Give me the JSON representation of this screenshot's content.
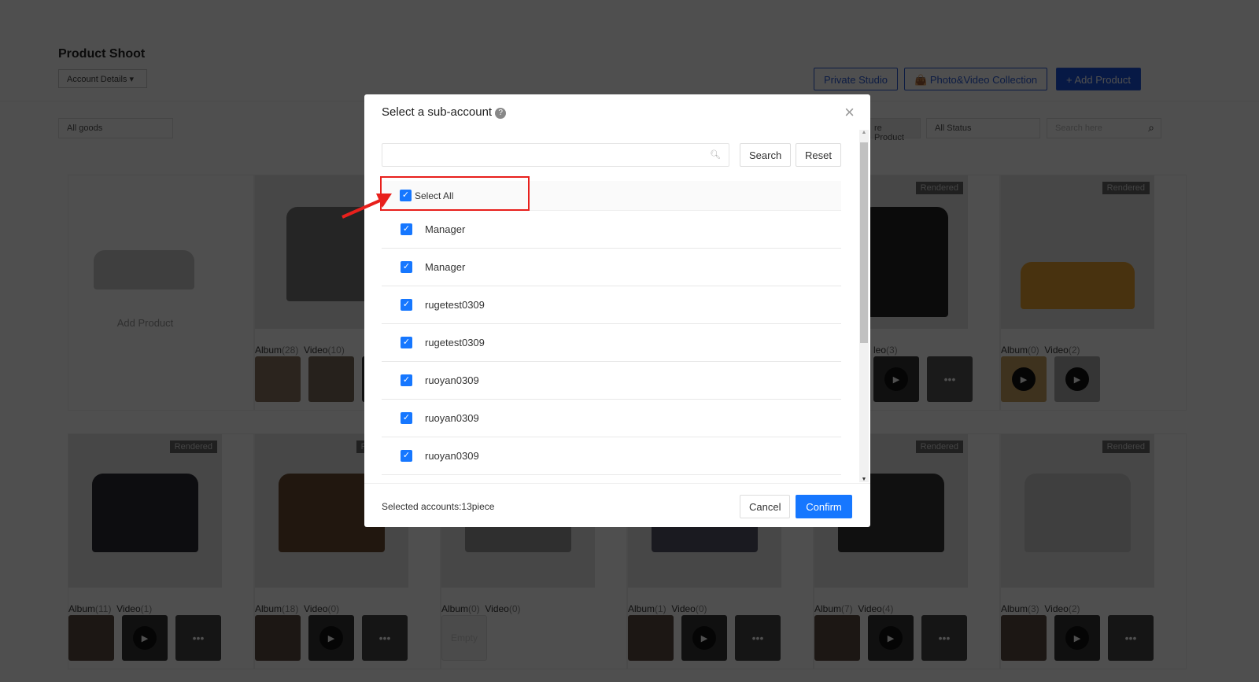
{
  "header": {
    "title": "Product Shoot",
    "account_dropdown": "Account Details",
    "private_studio": "Private Studio",
    "collection": "Photo&Video Collection",
    "add_product": "Add Product"
  },
  "filters": {
    "goods": "All goods",
    "product_tab": "re Product",
    "status": "All Status",
    "search_placeholder": "Search here"
  },
  "add_card": {
    "label": "Add Product"
  },
  "badge": "Rendered",
  "row1": [
    {
      "album": "Album",
      "album_n": "(28)",
      "video": "Video",
      "video_n": "(10)"
    },
    {
      "video": "leo",
      "video_n": "(3)"
    },
    {
      "album": "Album",
      "album_n": "(0)",
      "video": "Video",
      "video_n": "(2)"
    }
  ],
  "row2": [
    {
      "album": "Album",
      "album_n": "(11)",
      "video": "Video",
      "video_n": "(1)"
    },
    {
      "album": "Album",
      "album_n": "(18)",
      "video": "Video",
      "video_n": "(0)"
    },
    {
      "album": "Album",
      "album_n": "(0)",
      "video": "Video",
      "video_n": "(0)",
      "empty": "Empty"
    },
    {
      "album": "Album",
      "album_n": "(1)",
      "video": "Video",
      "video_n": "(0)"
    },
    {
      "album": "Album",
      "album_n": "(7)",
      "video": "Video",
      "video_n": "(4)"
    },
    {
      "album": "Album",
      "album_n": "(3)",
      "video": "Video",
      "video_n": "(2)"
    }
  ],
  "modal": {
    "title": "Select a sub-account",
    "search_value": "",
    "search": "Search",
    "reset": "Reset",
    "select_all": "Select All",
    "accounts": [
      "Manager",
      "Manager",
      "rugetest0309",
      "rugetest0309",
      "ruoyan0309",
      "ruoyan0309",
      "ruoyan0309"
    ],
    "selected": "Selected accounts:13piece",
    "cancel": "Cancel",
    "confirm": "Confirm"
  },
  "colors": {
    "accent": "#1677ff",
    "annotation": "#e8201c"
  }
}
